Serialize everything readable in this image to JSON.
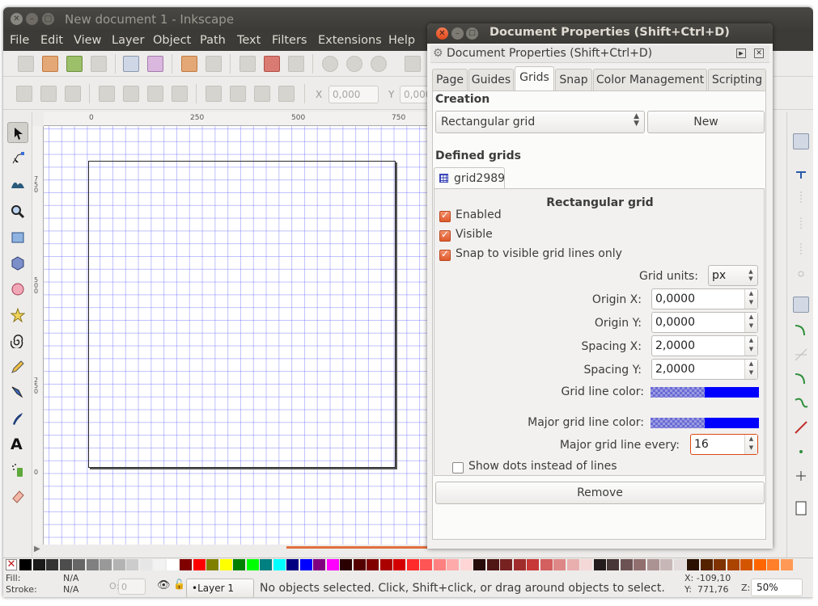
{
  "window": {
    "title": "New document 1 - Inkscape"
  },
  "menubar": [
    "File",
    "Edit",
    "View",
    "Layer",
    "Object",
    "Path",
    "Text",
    "Filters",
    "Extensions",
    "Help"
  ],
  "toolctrl": {
    "x_label": "X",
    "x_value": "0,000",
    "y_label": "Y",
    "y_value": "0,000"
  },
  "rulers": {
    "h_labels": [
      "0",
      "250",
      "500",
      "750"
    ],
    "v_labels": [
      "7\n5\n0",
      "5\n0\n0",
      "2\n5\n0",
      "0"
    ]
  },
  "statusbar": {
    "fill_label": "Fill:",
    "fill_value": "N/A",
    "stroke_label": "Stroke:",
    "stroke_value": "N/A",
    "opacity_label": "O:",
    "opacity_value": "0",
    "layer": "•Layer 1",
    "message": "No objects selected. Click, Shift+click, or drag around objects to select.",
    "cursor_x": "X: -109,10",
    "cursor_y": "Y:  771,76",
    "zoom_label": "Z:",
    "zoom_value": "50%"
  },
  "palette": [
    "#000000",
    "#1a1a1a",
    "#333333",
    "#4d4d4d",
    "#666666",
    "#808080",
    "#999999",
    "#b3b3b3",
    "#cccccc",
    "#e6e6e6",
    "#f2f2f2",
    "#ffffff",
    "#800000",
    "#ff0000",
    "#808000",
    "#ffff00",
    "#008000",
    "#00ff00",
    "#008080",
    "#00ffff",
    "#000080",
    "#0000ff",
    "#800080",
    "#ff00ff",
    "#2b0000",
    "#550000",
    "#800000",
    "#aa0000",
    "#d40000",
    "#ff2a2a",
    "#ff5555",
    "#ff8080",
    "#ffaaaa",
    "#ffd5d5",
    "#280b0b",
    "#501616",
    "#782121",
    "#a02c2c",
    "#c83737",
    "#d35f5f",
    "#de8787",
    "#e9afaf",
    "#f4d7d7",
    "#241c1c",
    "#483737",
    "#6c5353",
    "#916f6f",
    "#ac9393",
    "#c8b7b7",
    "#e3dbdb",
    "#2b1100",
    "#552200",
    "#803300",
    "#aa4400",
    "#d45500",
    "#ff6600",
    "#ff7f2a",
    "#ff9955"
  ],
  "dialog": {
    "title": "Document Properties (Shift+Ctrl+D)",
    "dock_title": "Document Properties (Shift+Ctrl+D)",
    "tabs": [
      "Page",
      "Guides",
      "Grids",
      "Snap",
      "Color Management",
      "Scripting"
    ],
    "active_tab": "Grids",
    "creation": {
      "title": "Creation",
      "grid_type": "Rectangular grid",
      "new_label": "New"
    },
    "defined": {
      "title": "Defined grids",
      "grid_name": "grid2989",
      "grid_type_title": "Rectangular grid",
      "enabled_label": "Enabled",
      "enabled": true,
      "visible_label": "Visible",
      "visible": true,
      "snap_label": "Snap to visible grid lines only",
      "snap": true,
      "units_label": "Grid units:",
      "units_value": "px",
      "origin_x_label": "Origin X:",
      "origin_x": "0,0000",
      "origin_y_label": "Origin Y:",
      "origin_y": "0,0000",
      "spacing_x_label": "Spacing X:",
      "spacing_x": "2,0000",
      "spacing_y_label": "Spacing Y:",
      "spacing_y": "2,0000",
      "grid_color_label": "Grid line color:",
      "grid_color": "#0000ff",
      "major_color_label": "Major grid line color:",
      "major_color": "#0000ff",
      "major_every_label": "Major grid line every:",
      "major_every": "16",
      "dots_label": "Show dots instead of lines",
      "dots": false,
      "remove_label": "Remove"
    }
  },
  "colors": {
    "accent": "#dd4814",
    "titlebar": "#3c3b37",
    "grid": "#5a5aff"
  }
}
